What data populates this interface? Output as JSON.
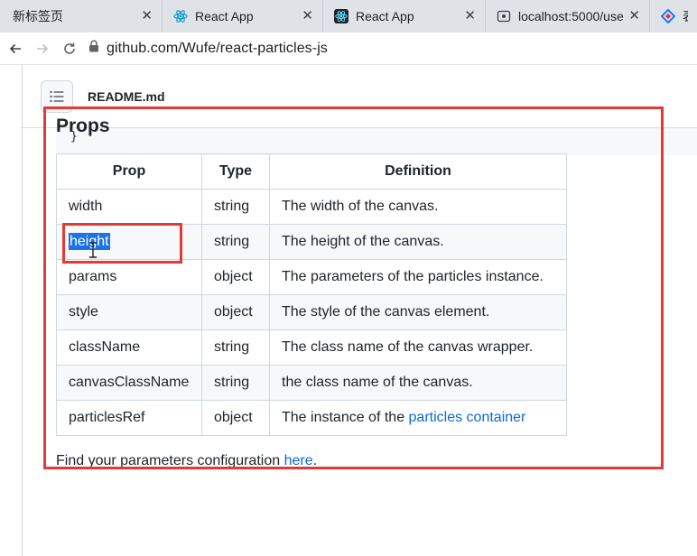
{
  "browser": {
    "tabs": [
      {
        "title": "新标签页",
        "icon": "blank-tab-icon",
        "active": false
      },
      {
        "title": "React App",
        "icon": "react-logo-icon",
        "active": false
      },
      {
        "title": "React App",
        "icon": "react-logo-icon",
        "active": true
      },
      {
        "title": "localhost:5000/use",
        "icon": "local-page-icon",
        "active": false
      },
      {
        "title": "表单",
        "icon": "app-logo-icon",
        "active": false
      }
    ],
    "close_glyph": "✕",
    "url": "github.com/Wufe/react-particles-js"
  },
  "readme": {
    "file_name": "README.md",
    "code_tail": "}",
    "props_heading": "Props",
    "table": {
      "headers": [
        "Prop",
        "Type",
        "Definition"
      ],
      "rows": [
        {
          "prop": "width",
          "type": "string",
          "definition": "The width of the canvas."
        },
        {
          "prop": "height",
          "type": "string",
          "definition": "The height of the canvas.",
          "selected": true
        },
        {
          "prop": "params",
          "type": "object",
          "definition": "The parameters of the particles instance."
        },
        {
          "prop": "style",
          "type": "object",
          "definition": "The style of the canvas element."
        },
        {
          "prop": "className",
          "type": "string",
          "definition": "The class name of the canvas wrapper."
        },
        {
          "prop": "canvasClassName",
          "type": "string",
          "definition": "the class name of the canvas."
        },
        {
          "prop": "particlesRef",
          "type": "object",
          "definition_prefix": "The instance of the ",
          "definition_link": "particles container"
        }
      ]
    },
    "find_prefix": "Find your parameters configuration ",
    "find_link": "here",
    "find_suffix": "."
  },
  "colors": {
    "highlight": "#e53935",
    "link": "#0969da",
    "selection": "#1a73e8"
  }
}
